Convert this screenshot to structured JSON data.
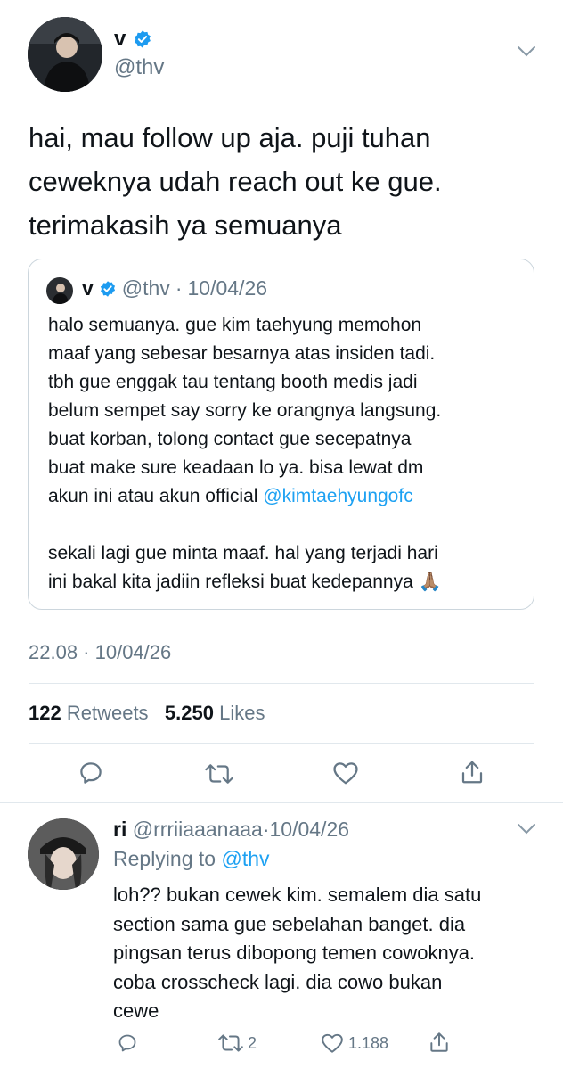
{
  "tweet": {
    "display_name": "v",
    "handle": "@thv",
    "text_lines": [
      "hai, mau follow up aja. puji tuhan",
      "ceweknya udah reach out ke gue.",
      "terimakasih ya semuanya"
    ],
    "quoted": {
      "display_name": "v",
      "handle": "@thv",
      "date": "10/04/26",
      "lines": [
        "halo semuanya. gue kim taehyung memohon",
        "maaf yang sebesar besarnya atas insiden tadi.",
        "tbh gue enggak tau tentang booth medis jadi",
        "belum sempet say sorry ke orangnya langsung.",
        "buat korban, tolong contact gue secepatnya",
        "buat make sure keadaan lo ya. bisa lewat dm"
      ],
      "line7_prefix": "akun ini atau akun official",
      "mention": "@kimtaehyungofc",
      "lines2": [
        "sekali lagi gue minta maaf. hal yang terjadi hari",
        "ini bakal kita jadiin refleksi buat kedepannya"
      ],
      "emoji": "🙏🏽"
    },
    "timestamp": "22.08 · 10/04/26",
    "retweets_count": "122",
    "retweets_label": "Retweets",
    "likes_count": "5.250",
    "likes_label": "Likes"
  },
  "reply": {
    "display_name": "ri",
    "handle": "@rrriiaaanaaa",
    "date": "10/04/26",
    "replying_to_label": "Replying to",
    "replying_to_handle": "@thv",
    "text_lines": [
      "loh?? bukan cewek kim. semalem dia satu",
      "section sama gue sebelahan banget. dia",
      "pingsan terus dibopong temen cowoknya.",
      "coba crosscheck lagi. dia cowo bukan",
      "cewe"
    ],
    "retweets": "2",
    "likes": "1.188"
  },
  "colors": {
    "accent": "#1da1f2",
    "muted": "#657786",
    "verified": "#1d9bf0"
  }
}
